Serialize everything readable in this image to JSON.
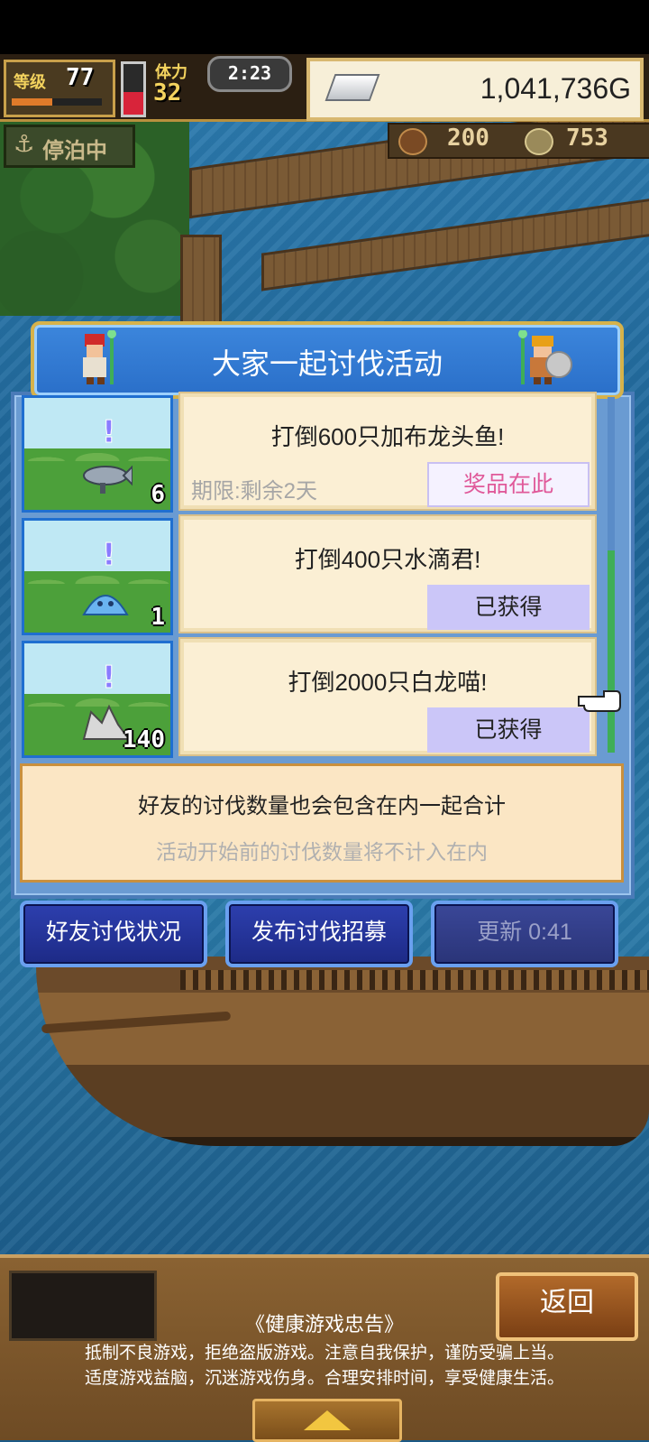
{
  "hud": {
    "level_label": "等级",
    "level": "77",
    "level_progress": 0.45,
    "stamina_label": "体力",
    "stamina": "32",
    "stamina_fill": 0.45,
    "timer": "2:23",
    "gold": "1,041,736G",
    "status_badge": "停泊中",
    "resource1": "200",
    "resource2": "753"
  },
  "event": {
    "title": "大家一起讨伐活动",
    "rows": [
      {
        "title": "打倒600只加布龙头鱼!",
        "deadline": "期限:剩余2天",
        "button": "奖品在此",
        "count": "6",
        "state": "prize"
      },
      {
        "title": "打倒400只水滴君!",
        "deadline": "",
        "button": "已获得",
        "count": "1",
        "state": "got"
      },
      {
        "title": "打倒2000只白龙喵!",
        "deadline": "",
        "button": "已获得",
        "count": "140",
        "state": "got"
      }
    ],
    "notice_line1": "好友的讨伐数量也会包含在内一起合计",
    "notice_line2": "活动开始前的讨伐数量将不计入在内"
  },
  "actions": {
    "friend_status": "好友讨伐状况",
    "post_recruit": "发布讨伐招募",
    "refresh": "更新 0:41"
  },
  "bottom": {
    "back": "返回",
    "health_title": "《健康游戏忠告》",
    "health_line1": "抵制不良游戏，拒绝盗版游戏。注意自我保护，谨防受骗上当。",
    "health_line2": "适度游戏益脑，沉迷游戏伤身。合理安排时间，享受健康生活。"
  },
  "colors": {
    "banner_blue": "#2a6fc9",
    "button_blue": "#1d2a86",
    "prize_text": "#e05a9a",
    "got_bg": "#cbc6f8"
  }
}
